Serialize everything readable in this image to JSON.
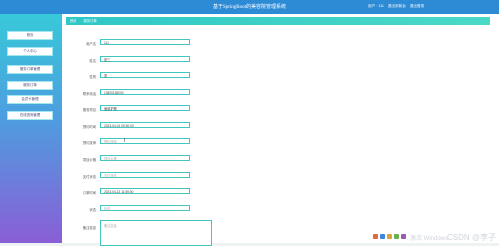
{
  "header": {
    "title": "基于SpringBoot的美容院管理系统",
    "user_label": "用户 · 111",
    "link_front": "退出到前台",
    "link_logout": "退出登录"
  },
  "sidebar": {
    "items": [
      {
        "label": "首页"
      },
      {
        "label": "个人中心"
      },
      {
        "label": "服务订单管理"
      },
      {
        "label": "服务订单"
      },
      {
        "label": "会员卡管理"
      },
      {
        "label": "在线咨询管理"
      }
    ]
  },
  "breadcrumb": {
    "home": "首页",
    "current": "服务订单"
  },
  "form": {
    "fields": [
      {
        "label": "用户名",
        "value": "111",
        "placeholder": false
      },
      {
        "label": "姓名",
        "value": "张三",
        "placeholder": false
      },
      {
        "label": "性别",
        "value": "男",
        "placeholder": false
      },
      {
        "label": "联系电话",
        "value": "13800138000",
        "placeholder": false
      },
      {
        "label": "服务项目",
        "value": "面部护理",
        "placeholder": false
      },
      {
        "label": "预约时间",
        "value": "2023-04-01 09:30:00",
        "placeholder": false
      },
      {
        "label": "预约技师",
        "value": "预约技师",
        "placeholder": true
      },
      {
        "label": "项目价格",
        "value": "项目价格",
        "placeholder": true
      },
      {
        "label": "支付状态",
        "value": "支付状态",
        "placeholder": true
      },
      {
        "label": "订单时间",
        "value": "2023-04-13 11:55:00",
        "placeholder": false
      },
      {
        "label": "状态",
        "value": "状态",
        "placeholder": true
      }
    ],
    "remark_label": "备注信息",
    "remark_placeholder": "备注信息"
  },
  "watermark": "CSDN @李子",
  "windows_text": "激活 Windows"
}
